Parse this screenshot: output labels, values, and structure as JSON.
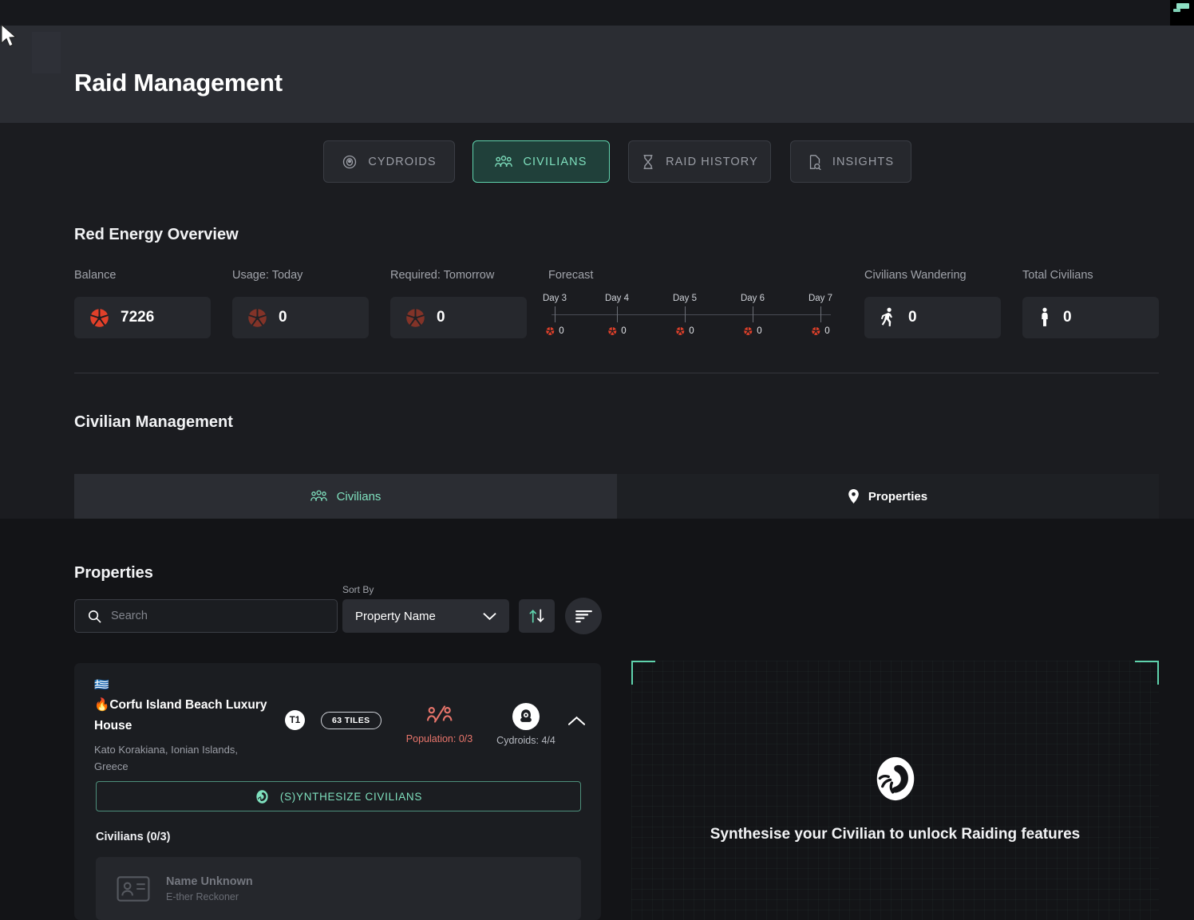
{
  "header": {
    "title": "Raid Management"
  },
  "main_tabs": [
    {
      "label": "CYDROIDS",
      "icon": "cydroid-head-icon",
      "active": false
    },
    {
      "label": "CIVILIANS",
      "icon": "people-group-icon",
      "active": true
    },
    {
      "label": "RAID HISTORY",
      "icon": "hourglass-icon",
      "active": false
    },
    {
      "label": "INSIGHTS",
      "icon": "document-search-icon",
      "active": false
    }
  ],
  "red_energy": {
    "section_title": "Red Energy Overview",
    "stats": [
      {
        "label": "Balance",
        "value": "7226",
        "icon": "red-energy-icon"
      },
      {
        "label": "Usage: Today",
        "value": "0",
        "icon": "red-energy-icon"
      },
      {
        "label": "Required: Tomorrow",
        "value": "0",
        "icon": "red-energy-icon"
      },
      {
        "label": "Civilians Wandering",
        "value": "0",
        "icon": "walking-person-icon"
      },
      {
        "label": "Total Civilians",
        "value": "0",
        "icon": "standing-person-icon"
      }
    ],
    "forecast": {
      "label": "Forecast",
      "days": [
        {
          "day": "Day 3",
          "value": "0"
        },
        {
          "day": "Day 4",
          "value": "0"
        },
        {
          "day": "Day 5",
          "value": "0"
        },
        {
          "day": "Day 6",
          "value": "0"
        },
        {
          "day": "Day 7",
          "value": "0"
        }
      ]
    }
  },
  "civilian_management": {
    "section_title": "Civilian Management",
    "tabs": [
      {
        "label": "Civilians",
        "icon": "people-group-icon",
        "active": false
      },
      {
        "label": "Properties",
        "icon": "map-pin-icon",
        "active": true
      }
    ]
  },
  "properties": {
    "title": "Properties",
    "search": {
      "placeholder": "Search",
      "value": "",
      "icon": "search-icon"
    },
    "sort": {
      "label": "Sort By",
      "selected": "Property Name",
      "options": [
        "Property Name"
      ],
      "direction_icon": "sort-ascending-icon",
      "filter_icon": "filter-lines-icon"
    },
    "card": {
      "flag": "🇬🇷",
      "fire": "🔥",
      "name": "Corfu Island Beach Luxury House",
      "address": "Kato Korakiana, Ionian Islands, Greece",
      "tier": "T1",
      "tiles": "63 TILES",
      "population": "Population: 0/3",
      "population_icon": "users-slash-icon",
      "cydroids": "Cydroids: 4/4",
      "cydroid_icon": "cydroid-head-icon",
      "collapse_icon": "chevron-up-icon",
      "synthesize_label": "(S)YNTHESIZE CIVILIANS",
      "synthesize_icon": "embryo-icon",
      "civilians_heading": "Civilians (0/3)",
      "civilians": [
        {
          "name": "Name Unknown",
          "role": "E-ther Reckoner",
          "icon": "id-card-icon"
        }
      ]
    }
  },
  "right_panel": {
    "icon": "embryo-icon",
    "message": "Synthesise your Civilian to unlock Raiding features"
  },
  "colors": {
    "accent_teal": "#7fe0be",
    "energy_red": "#e0402a",
    "population_red": "#e8756b",
    "page_bg": "#1b1c20",
    "panel_bg": "#131417"
  }
}
